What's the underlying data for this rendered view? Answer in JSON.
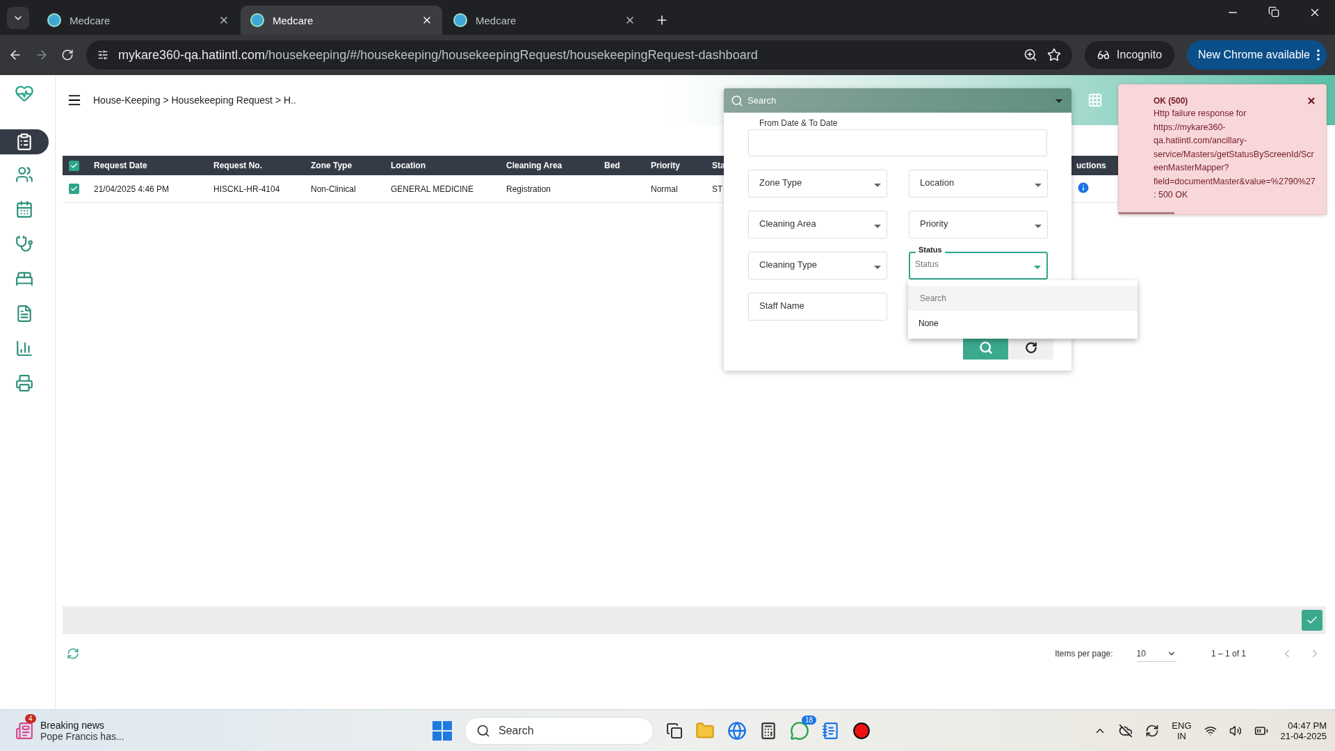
{
  "browser": {
    "tabs": [
      {
        "title": "Medcare",
        "selected": false
      },
      {
        "title": "Medcare",
        "selected": true
      },
      {
        "title": "Medcare",
        "selected": false
      }
    ],
    "url_host": "mykare360-qa.hatiintl.com",
    "url_path": "/housekeeping/#/housekeeping/housekeepingRequest/housekeepingRequest-dashboard",
    "incognito_label": "Incognito",
    "update_button": "New Chrome available"
  },
  "sidebar": {
    "items": [
      {
        "kind": "cleaning",
        "selected": true
      },
      {
        "kind": "staff",
        "selected": false
      },
      {
        "kind": "calendar",
        "selected": false
      },
      {
        "kind": "care",
        "selected": false
      },
      {
        "kind": "bed",
        "selected": false
      },
      {
        "kind": "notes",
        "selected": false
      },
      {
        "kind": "report",
        "selected": false
      },
      {
        "kind": "printer",
        "selected": false
      }
    ]
  },
  "header": {
    "breadcrumb": "House-Keeping > Housekeeping Request > H.."
  },
  "table": {
    "all_checked": true,
    "columns": [
      "Request Date",
      "Request No.",
      "Zone Type",
      "Location",
      "Cleaning Area",
      "Bed",
      "Priority",
      "Sta",
      "uctions"
    ],
    "rows": [
      {
        "checked": true,
        "request_date": "21/04/2025 4:46 PM",
        "request_no": "HISCKL-HR-4104",
        "zone_type": "Non-Clinical",
        "location": "GENERAL MEDICINE",
        "cleaning_area": "Registration",
        "priority": "Normal",
        "status": "ST"
      }
    ]
  },
  "filter_panel": {
    "search_label": "Search",
    "fields": [
      {
        "label": "From Date & To Date",
        "kind": "date",
        "focused": false
      },
      {
        "label": "Zone Type",
        "kind": "select",
        "focused": false
      },
      {
        "label": "Location",
        "kind": "select",
        "focused": false
      },
      {
        "label": "Cleaning Area",
        "kind": "select",
        "focused": false
      },
      {
        "label": "Priority",
        "kind": "select",
        "focused": false
      },
      {
        "label": "Cleaning Type",
        "kind": "select",
        "focused": false
      },
      {
        "label": "Status",
        "kind": "select",
        "focused": true,
        "placeholder": "Status"
      },
      {
        "label": "Staff Name",
        "kind": "text",
        "focused": false
      }
    ]
  },
  "status_dropdown": {
    "search_placeholder": "Search",
    "options": [
      "None"
    ]
  },
  "toast": {
    "title": "OK (500)",
    "message": "Http failure response for https://mykare360-qa.hatiintl.com/ancillary-service/Masters/getStatusByScreenId/ScreenMasterMapper?field=documentMaster&value=%2790%27: 500 OK",
    "level": 0.27
  },
  "pagination": {
    "items_per_page_label": "Items per page:",
    "page_size": "10",
    "range": "1 – 1 of 1"
  },
  "taskbar": {
    "news_badge": "4",
    "news_title": "Breaking news",
    "news_text": "Pope Francis has...",
    "search_placeholder": "Search",
    "chat_badge": "18",
    "language": "ENG",
    "region": "IN",
    "time": "04:47 PM",
    "date": "21-04-2025"
  }
}
